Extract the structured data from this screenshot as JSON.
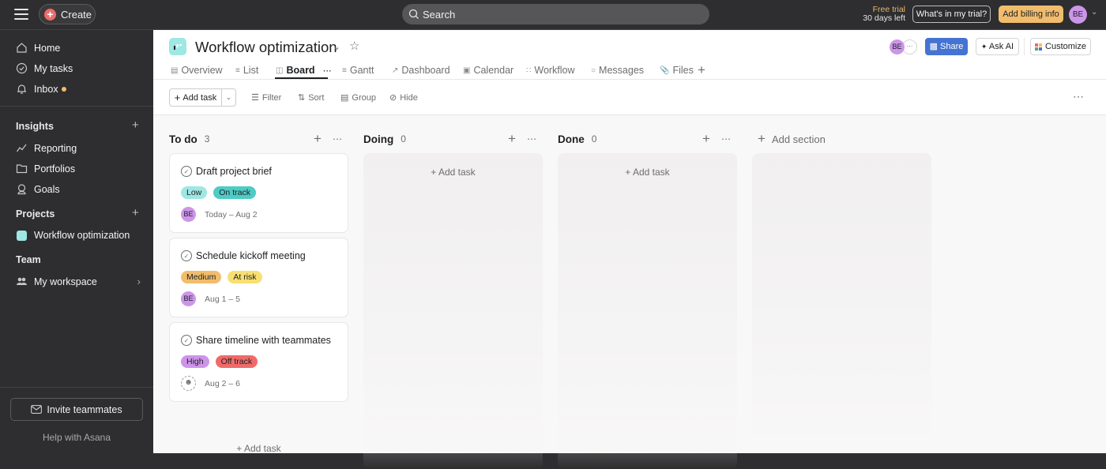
{
  "topbar": {
    "create_label": "Create",
    "search_placeholder": "Search",
    "trial_line1": "Free trial",
    "trial_line2": "30 days left",
    "whats_in_trial": "What's in my trial?",
    "add_billing": "Add billing info",
    "user_initials": "BE"
  },
  "sidebar": {
    "nav": [
      {
        "label": "Home",
        "icon": "home-icon"
      },
      {
        "label": "My tasks",
        "icon": "check-circle-icon"
      },
      {
        "label": "Inbox",
        "icon": "bell-icon"
      }
    ],
    "insights_label": "Insights",
    "insights": [
      {
        "label": "Reporting",
        "icon": "reporting-icon"
      },
      {
        "label": "Portfolios",
        "icon": "folder-icon"
      },
      {
        "label": "Goals",
        "icon": "goals-icon"
      }
    ],
    "projects_label": "Projects",
    "projects": [
      {
        "label": "Workflow optimization",
        "color": "#9ee7e3"
      }
    ],
    "team_label": "Team",
    "team": [
      {
        "label": "My workspace"
      }
    ],
    "invite_label": "Invite teammates",
    "help_label": "Help with Asana"
  },
  "header": {
    "project_title": "Workflow optimization",
    "tabs": [
      {
        "label": "Overview"
      },
      {
        "label": "List"
      },
      {
        "label": "Board",
        "active": true
      },
      {
        "label": "Gantt"
      },
      {
        "label": "Dashboard"
      },
      {
        "label": "Calendar"
      },
      {
        "label": "Workflow"
      },
      {
        "label": "Messages"
      },
      {
        "label": "Files"
      }
    ],
    "member_initials": "BE",
    "share_label": "Share",
    "ask_ai_label": "Ask AI",
    "customize_label": "Customize"
  },
  "toolbar": {
    "add_task_label": "Add task",
    "filter_label": "Filter",
    "sort_label": "Sort",
    "group_label": "Group",
    "hide_label": "Hide"
  },
  "board": {
    "columns": [
      {
        "name": "To do",
        "count": "3",
        "tasks": [
          {
            "title": "Draft project brief",
            "priority": "Low",
            "status": "On track",
            "assignee": "BE",
            "dates": "Today – Aug 2"
          },
          {
            "title": "Schedule kickoff meeting",
            "priority": "Medium",
            "status": "At risk",
            "assignee": "BE",
            "dates": "Aug 1 – 5"
          },
          {
            "title": "Share timeline with teammates",
            "priority": "High",
            "status": "Off track",
            "assignee": "",
            "dates": "Aug 2 – 6"
          }
        ],
        "add_task_label": "Add task"
      },
      {
        "name": "Doing",
        "count": "0",
        "add_task_label": "Add task"
      },
      {
        "name": "Done",
        "count": "0",
        "add_task_label": "Add task"
      }
    ],
    "add_section_label": "Add section"
  },
  "colors": {
    "accent": "#4573d2",
    "create": "#f06a6a",
    "billing": "#f1bd6c",
    "tag_low": "#9ee7e3",
    "tag_on_track": "#4ecbc4",
    "tag_medium": "#f1bd6c",
    "tag_at_risk": "#f8df72",
    "tag_high": "#cd95ea",
    "tag_off_track": "#f06a6a"
  }
}
